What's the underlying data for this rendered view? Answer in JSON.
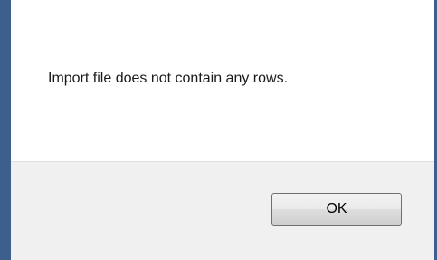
{
  "dialog": {
    "message": "Import file does not contain any rows.",
    "ok_label": "OK"
  },
  "colors": {
    "window_border": "#3d5f8e",
    "footer_background": "#f0f0f0",
    "content_background": "#ffffff"
  }
}
